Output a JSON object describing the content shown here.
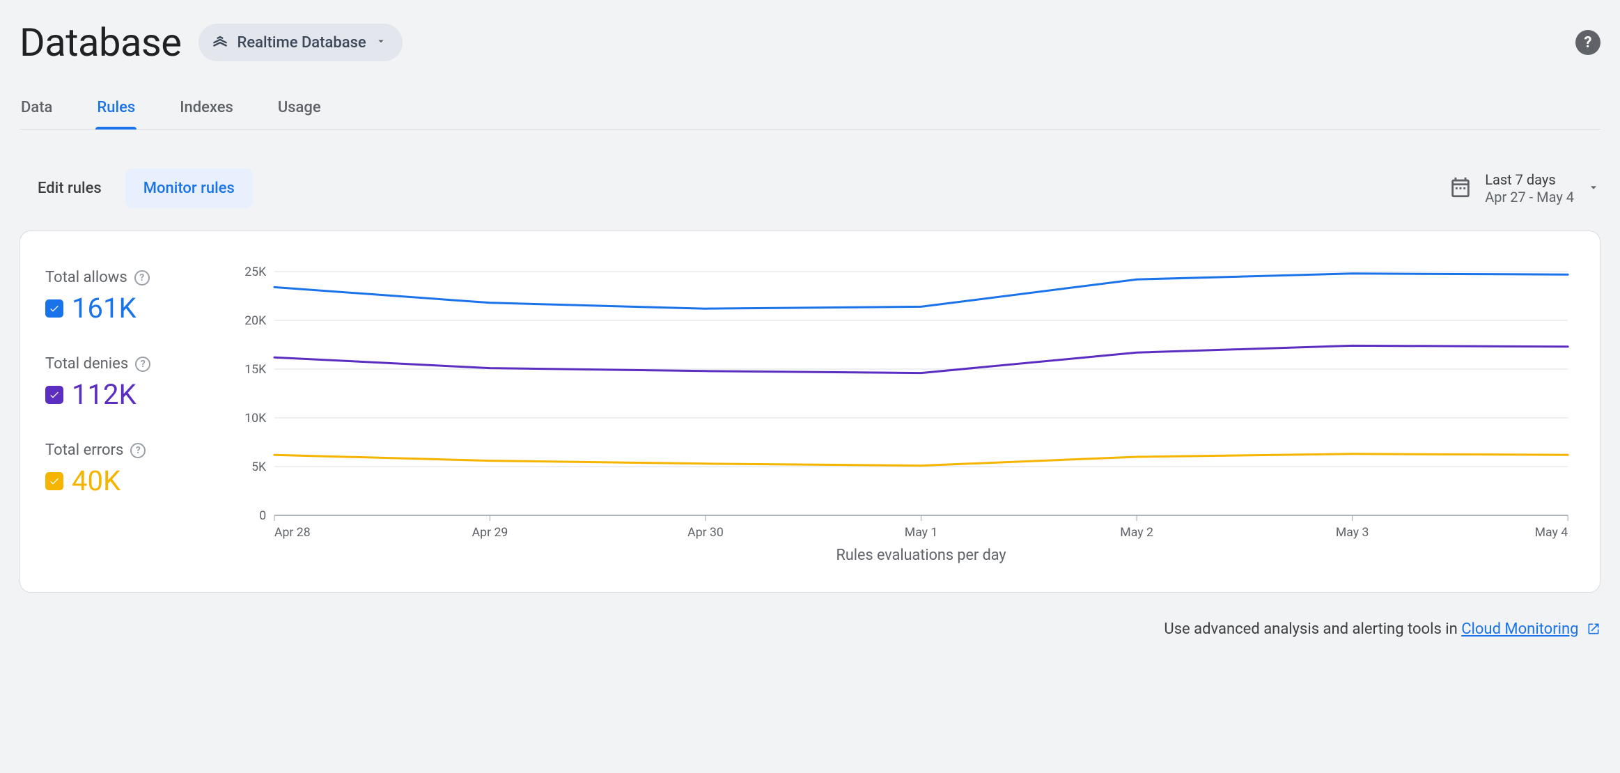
{
  "header": {
    "title": "Database",
    "selector_label": "Realtime Database"
  },
  "tabs": {
    "items": [
      {
        "label": "Data",
        "active": false
      },
      {
        "label": "Rules",
        "active": true
      },
      {
        "label": "Indexes",
        "active": false
      },
      {
        "label": "Usage",
        "active": false
      }
    ]
  },
  "subtabs": {
    "items": [
      {
        "label": "Edit rules",
        "active": false
      },
      {
        "label": "Monitor rules",
        "active": true
      }
    ]
  },
  "date_range": {
    "preset": "Last 7 days",
    "range": "Apr 27 - May 4"
  },
  "legend": {
    "allows": {
      "label": "Total allows",
      "value": "161K",
      "color": "#1a73e8"
    },
    "denies": {
      "label": "Total denies",
      "value": "112K",
      "color": "#5b2ec1"
    },
    "errors": {
      "label": "Total errors",
      "value": "40K",
      "color": "#f5b400"
    }
  },
  "chart_data": {
    "type": "line",
    "title": "",
    "xlabel": "Rules evaluations per day",
    "ylabel": "",
    "ylim": [
      0,
      25000
    ],
    "yticks": [
      0,
      5000,
      10000,
      15000,
      20000,
      25000
    ],
    "ytick_labels": [
      "0",
      "5K",
      "10K",
      "15K",
      "20K",
      "25K"
    ],
    "categories": [
      "Apr 28",
      "Apr 29",
      "Apr 30",
      "May 1",
      "May 2",
      "May 3",
      "May 4"
    ],
    "series": [
      {
        "name": "Total allows",
        "color": "#1a73e8",
        "values": [
          23400,
          21800,
          21200,
          21400,
          24200,
          24800,
          24700
        ]
      },
      {
        "name": "Total denies",
        "color": "#5b2ec1",
        "values": [
          16200,
          15100,
          14800,
          14600,
          16700,
          17400,
          17300
        ]
      },
      {
        "name": "Total errors",
        "color": "#f5b400",
        "values": [
          6200,
          5600,
          5300,
          5100,
          6000,
          6300,
          6200
        ]
      }
    ]
  },
  "footer": {
    "prefix": "Use advanced analysis and alerting tools in ",
    "link_label": "Cloud Monitoring"
  }
}
